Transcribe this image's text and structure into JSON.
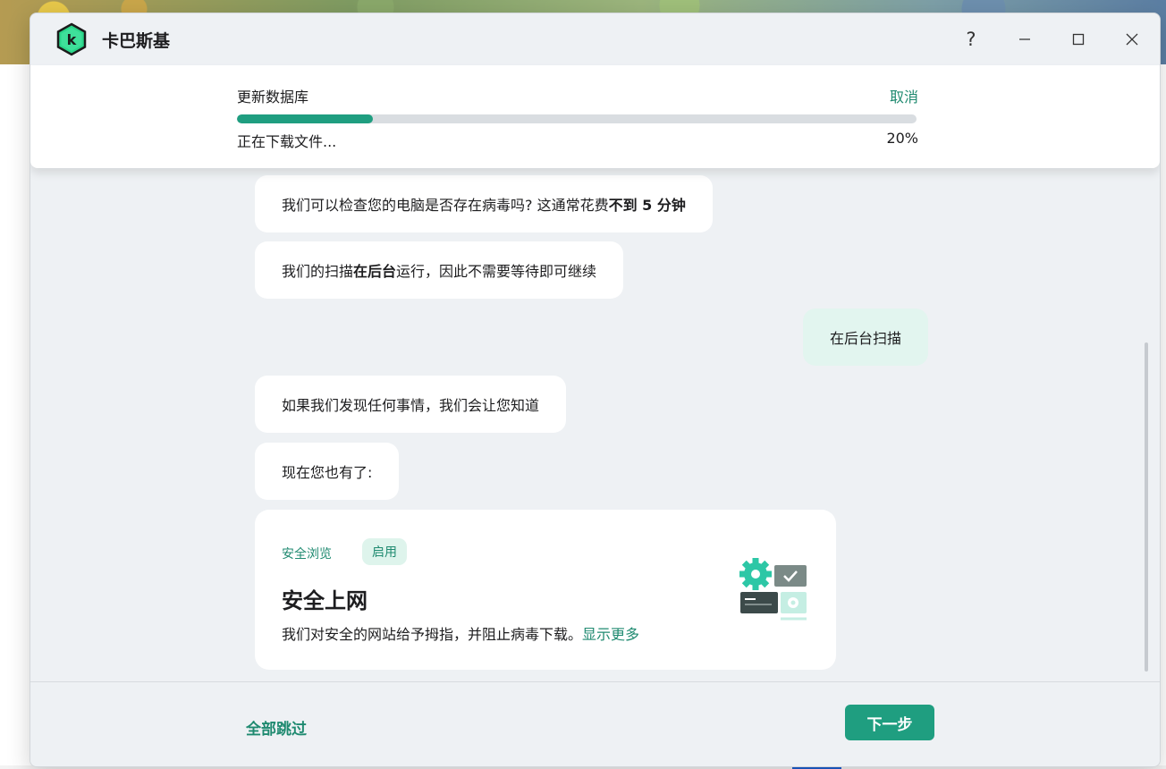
{
  "app": {
    "title": "卡巴斯基"
  },
  "window_controls": {
    "help": "?",
    "minimize": "—",
    "maximize": "☐",
    "close": "✕"
  },
  "update": {
    "title": "更新数据库",
    "cancel_label": "取消",
    "status": "正在下载文件...",
    "percent_label": "20%",
    "progress": 0.2
  },
  "chat": {
    "msg1": {
      "text": "我们可以检查您的电脑是否存在病毒吗? 这通常花费",
      "bold": "不到 5 分钟"
    },
    "msg2": {
      "text_before": "我们的扫描",
      "bold": "在后台",
      "text_after": "运行，因此不需要等待即可继续"
    },
    "user_reply": "在后台扫描",
    "msg3": "如果我们发现任何事情，我们会让您知道",
    "msg4": "现在您也有了:"
  },
  "feature": {
    "label": "安全浏览",
    "badge": "启用",
    "title": "安全上网",
    "description": "我们对安全的网站给予拇指，并阻止病毒下载。",
    "more_link": "显示更多",
    "icon": "safe-browsing-illustration"
  },
  "footer": {
    "skip_all": "全部跳过",
    "next": "下一步"
  },
  "colors": {
    "accent": "#1f9e80",
    "link": "#1f8a70",
    "user_bubble": "#e2f5ef",
    "background": "#eef1f4"
  }
}
